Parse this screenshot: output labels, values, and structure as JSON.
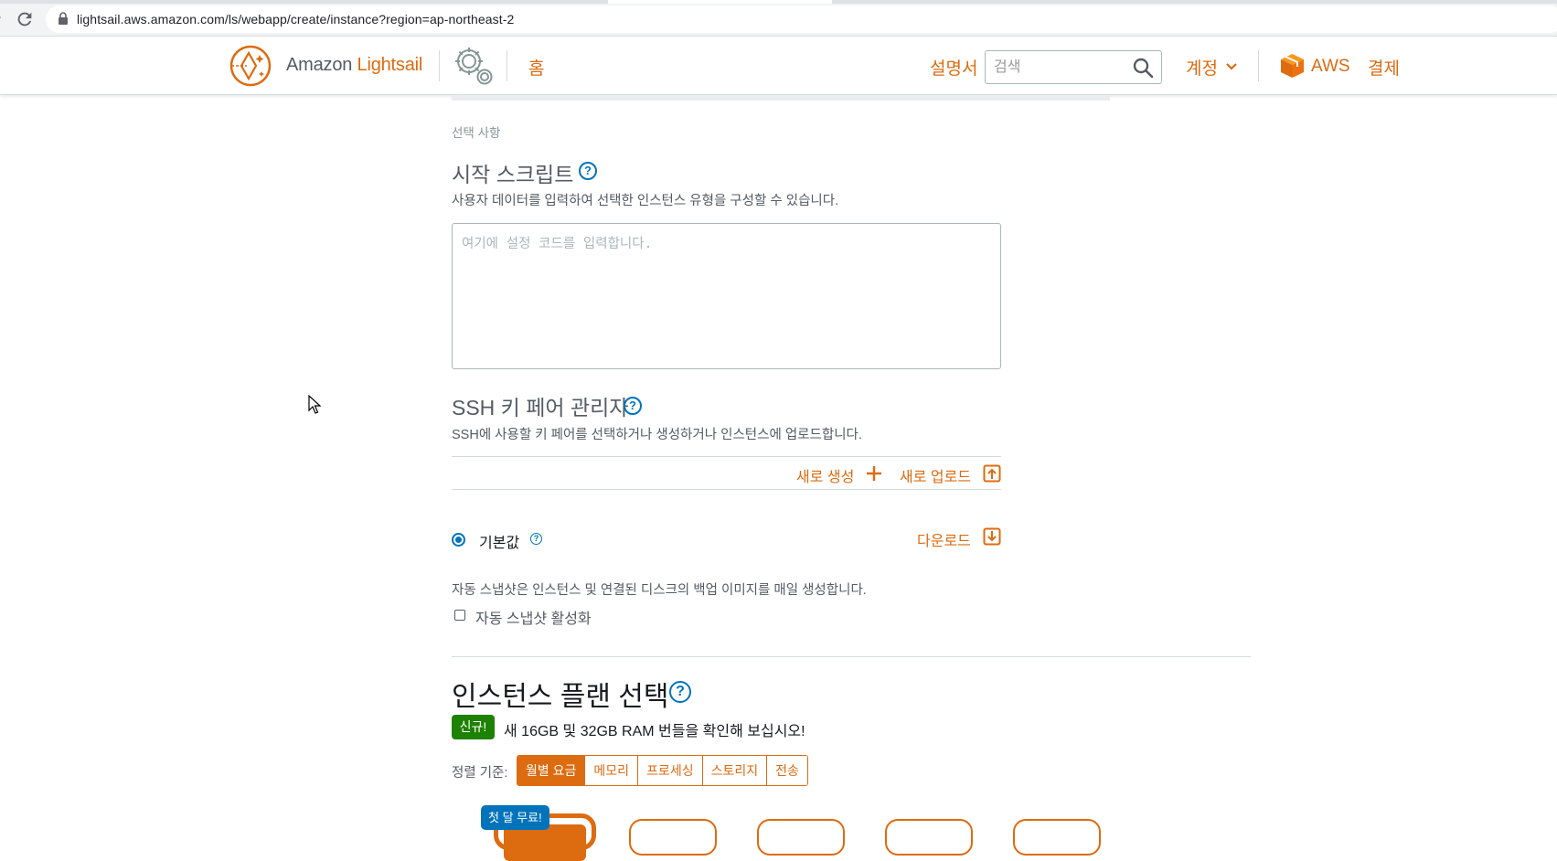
{
  "browser": {
    "url": "lightsail.aws.amazon.com/ls/webapp/create/instance?region=ap-northeast-2"
  },
  "header": {
    "logo_prefix": "Amazon ",
    "logo_brand": "Lightsail",
    "home": "홈",
    "docs": "설명서",
    "search_placeholder": "검색",
    "account": "계정",
    "aws": "AWS",
    "billing": "결제",
    "accent_color": "#dd6b10"
  },
  "launch_script": {
    "optional_label": "선택 사항",
    "title": "시작 스크립트",
    "description": "사용자 데이터를 입력하여 선택한 인스턴스 유형을 구성할 수 있습니다.",
    "placeholder": "여기에 설정 코드를 입력합니다."
  },
  "ssh": {
    "title": "SSH 키 페어 관리자",
    "description": "SSH에 사용할 키 페어를 선택하거나 생성하거나 인스턴스에 업로드합니다.",
    "create_new": "새로 생성",
    "upload_new": "새로 업로드",
    "default_label": "기본값",
    "download": "다운로드"
  },
  "snapshot": {
    "description": "자동 스냅샷은 인스턴스 및 연결된 디스크의 백업 이미지를 매일 생성합니다.",
    "checkbox_label": "자동 스냅샷 활성화",
    "checked": false
  },
  "plan": {
    "title": "인스턴스 플랜 선택",
    "new_badge": "신규!",
    "new_text": "새 16GB 및 32GB RAM 번들을 확인해 보십시오!",
    "sort_label": "정렬 기준:",
    "sort_options": [
      "월별 요금",
      "메모리",
      "프로세싱",
      "스토리지",
      "전송"
    ],
    "sort_selected": "월별 요금",
    "free_badge": "첫 달 무료!"
  },
  "help_glyph": "?"
}
